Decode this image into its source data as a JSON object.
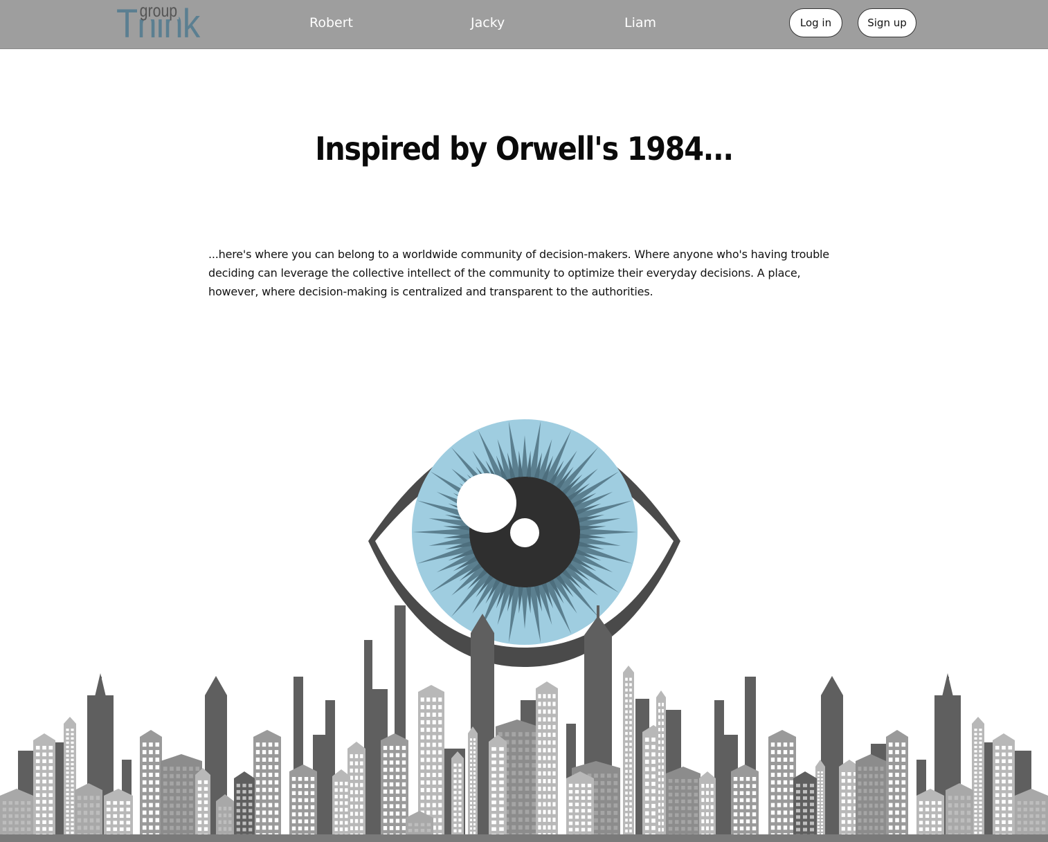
{
  "navbar": {
    "logo": {
      "small": "group",
      "large": "Think",
      "icon": "groupthink-logo"
    },
    "links": [
      "Robert",
      "Jacky",
      "Liam"
    ],
    "login_label": "Log in",
    "signup_label": "Sign up"
  },
  "hero": {
    "headline": "Inspired by Orwell's 1984...",
    "intro": "...here's where you can belong to a worldwide community of decision-makers. Where anyone who's having trouble deciding can leverage the collective intellect of the community to optimize their everyday decisions. A place, however, where decision-making is centralized and transparent to the authorities."
  },
  "illustration": {
    "subjects": [
      "watching-eye-icon",
      "city-skyline"
    ],
    "colors": {
      "navbar": "#9e9e9e",
      "eye_outline": "#4a4a4a",
      "iris_light": "#9fcde0",
      "iris_dark": "#5b7f8f",
      "pupil": "#2f2f2f",
      "building_dark": "#5f5f5f",
      "building_light": "#9a9a9a"
    }
  }
}
